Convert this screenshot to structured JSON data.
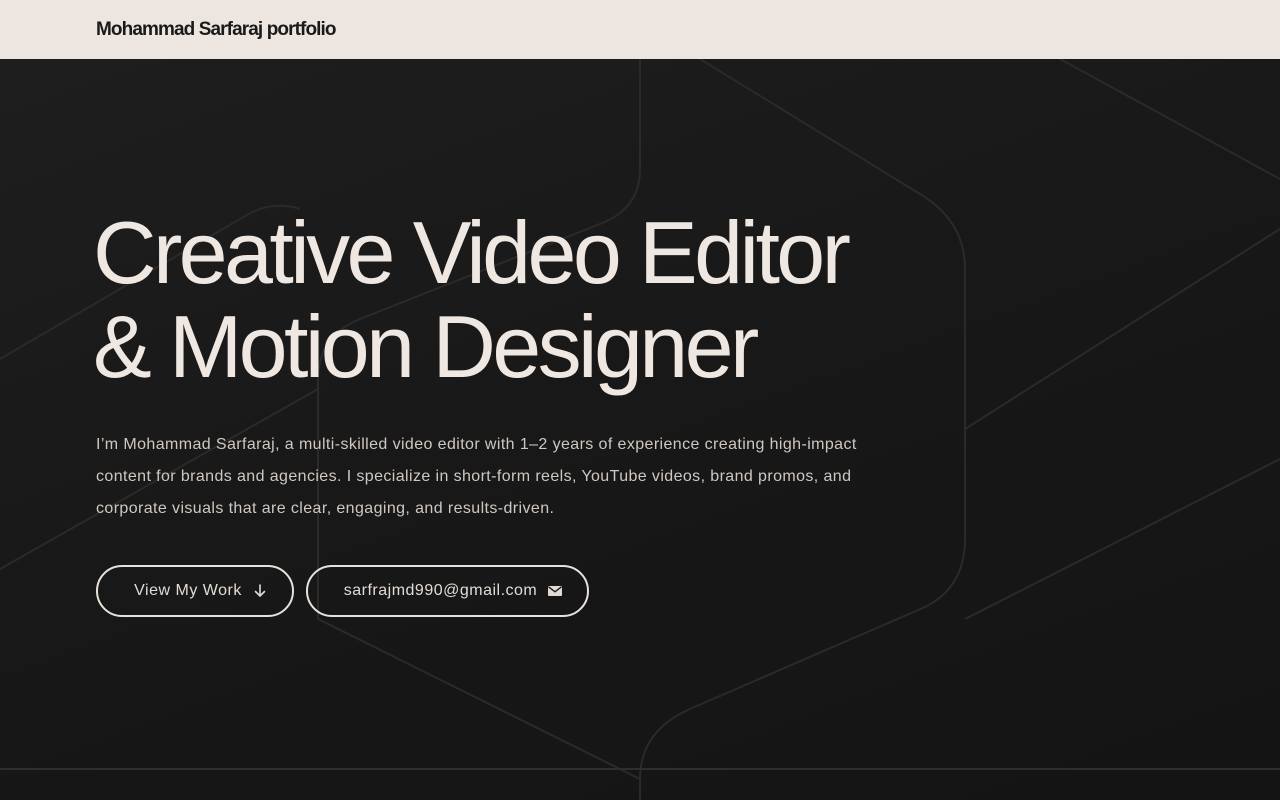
{
  "header": {
    "brand": "Mohammad Sarfaraj portfolio"
  },
  "hero": {
    "headline_line1": "Creative Video Editor",
    "headline_line2": "& Motion Designer",
    "intro": "I’m Mohammad Sarfaraj, a multi-skilled video editor with 1–2 years of experience creating high-impact content for brands and agencies. I specialize in short-form reels, YouTube videos, brand promos, and corporate visuals that are clear, engaging, and results-driven.",
    "buttons": {
      "work_label": "View My Work",
      "work_icon": "arrow-down-icon",
      "email_label": "sarfrajmd990@gmail.com",
      "email_icon": "mail-icon"
    }
  },
  "colors": {
    "header_bg": "#ede5df",
    "hero_bg": "#181818",
    "text_light": "#efe7e1",
    "text_muted": "#cfc8c2"
  }
}
